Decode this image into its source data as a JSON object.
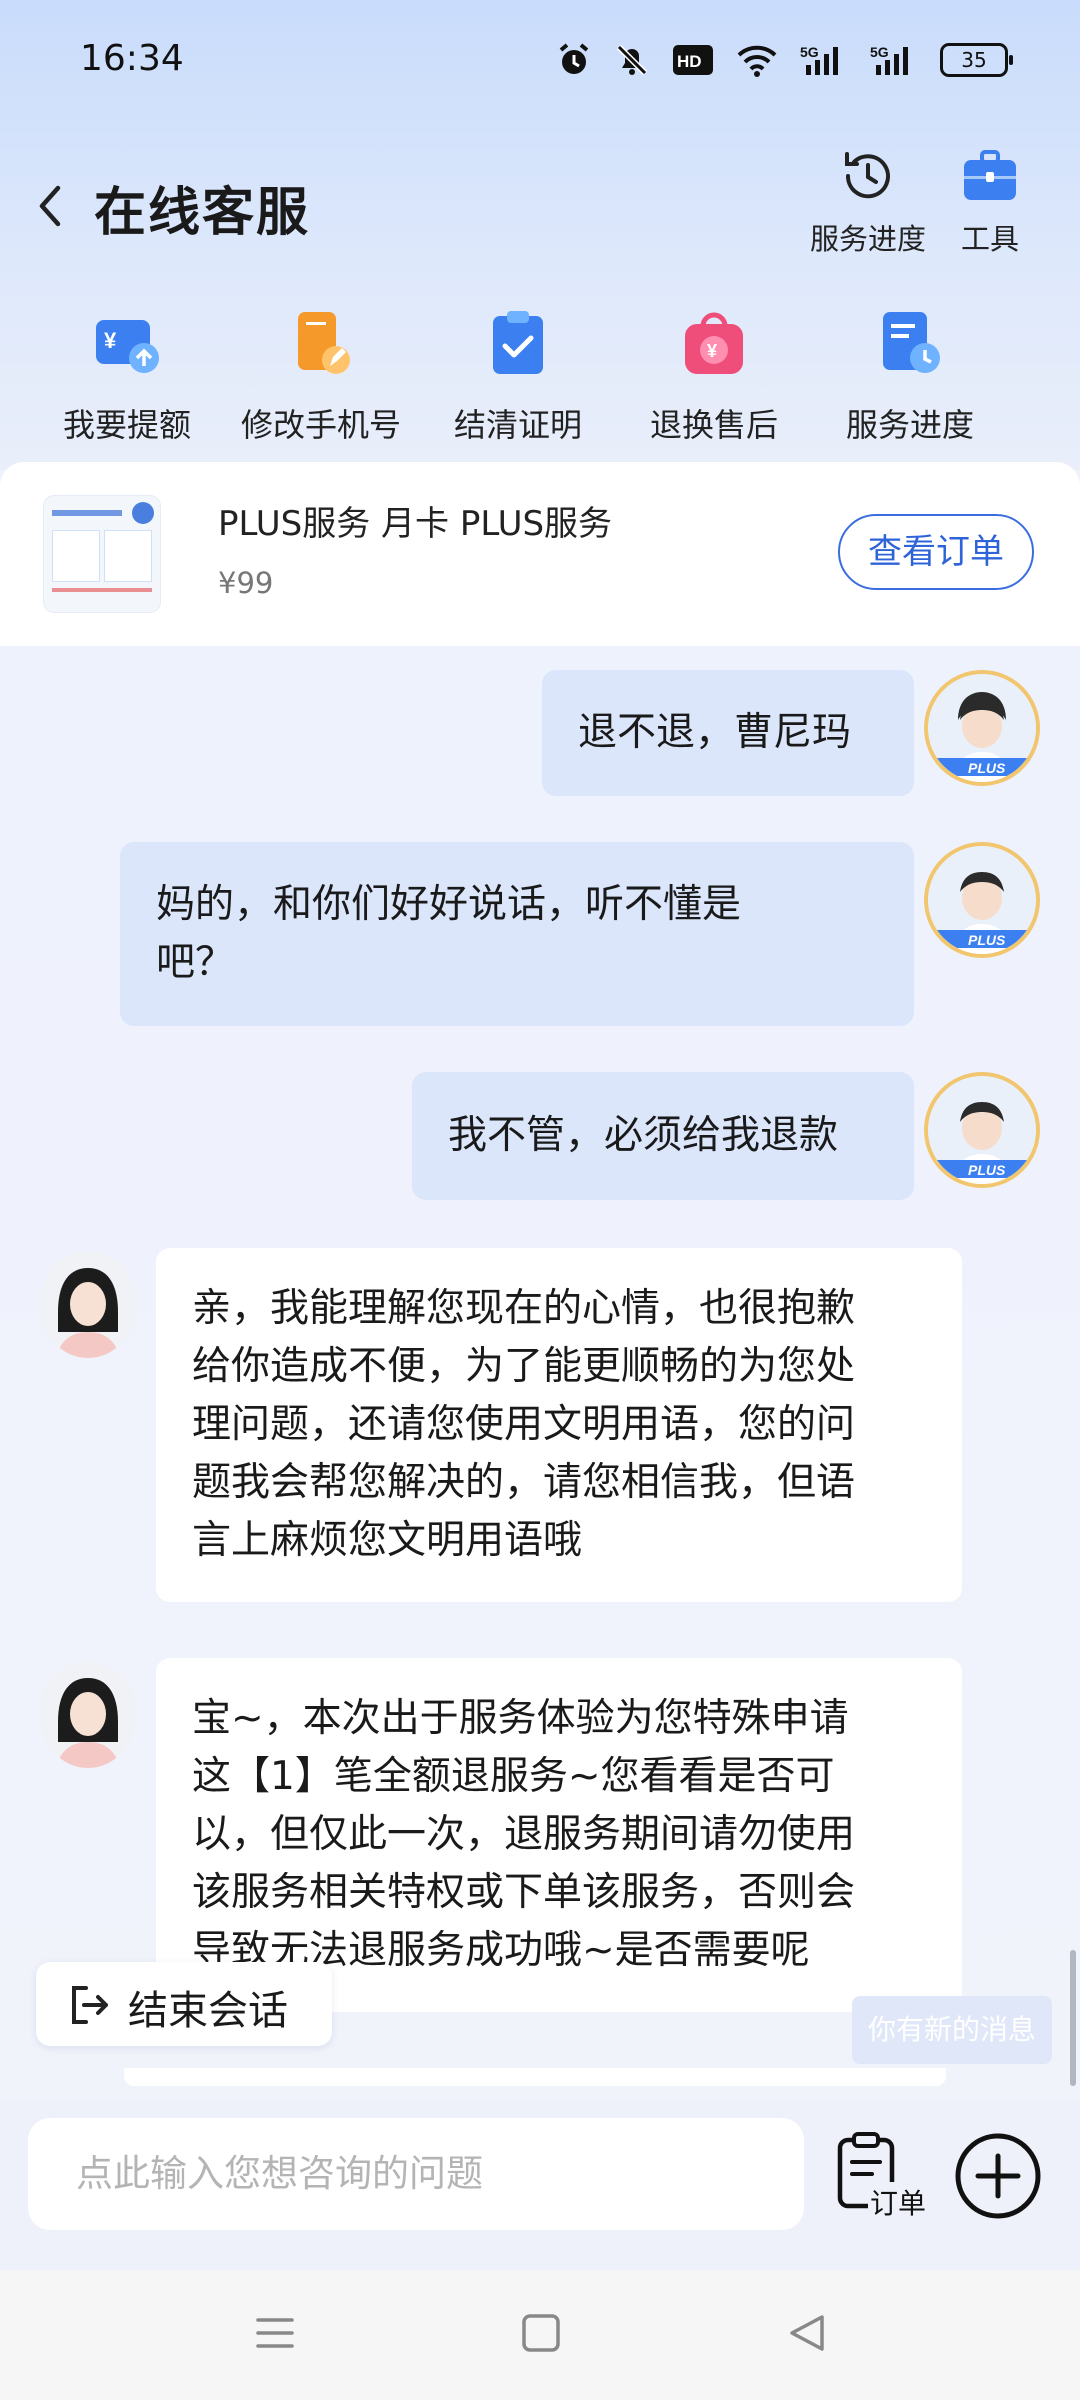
{
  "status_bar": {
    "time": "16:34",
    "icons": [
      "alarm-icon",
      "mute-icon",
      "hd-icon",
      "wifi-icon",
      "5g-signal-icon",
      "5g-signal-icon"
    ],
    "hd_label": "HD",
    "net_label": "5G",
    "battery": "35"
  },
  "header": {
    "title": "在线客服",
    "service_progress": "服务进度",
    "tools": "工具"
  },
  "quick_actions": [
    {
      "label": "我要提额",
      "icon": "wallet-raise-icon",
      "color": "#3b7ff0"
    },
    {
      "label": "修改手机号",
      "icon": "phone-edit-icon",
      "color": "#f59a2a"
    },
    {
      "label": "结清证明",
      "icon": "clipboard-check-icon",
      "color": "#3b7ff0"
    },
    {
      "label": "退换售后",
      "icon": "refund-bag-icon",
      "color": "#ef4d7a"
    },
    {
      "label": "服务进度",
      "icon": "doc-clock-icon",
      "color": "#3b7ff0"
    }
  ],
  "order": {
    "product_name": "PLUS服务 月卡 PLUS服务",
    "price": "¥99",
    "view_button": "查看订单"
  },
  "messages": [
    {
      "from": "user",
      "text": "退不退，曹尼玛"
    },
    {
      "from": "user",
      "lines": [
        "妈的，和你们好好说话，听不懂是",
        "吧？"
      ]
    },
    {
      "from": "user",
      "text": "我不管，必须给我退款"
    },
    {
      "from": "agent",
      "lines": [
        "亲，我能理解您现在的心情，也很抱歉",
        "给你造成不便，为了能更顺畅的为您处",
        "理问题，还请您使用文明用语，您的问",
        "题我会帮您解决的，请您相信我，但语",
        "言上麻烦您文明用语哦"
      ]
    },
    {
      "from": "agent",
      "lines": [
        "宝~，本次出于服务体验为您特殊申请",
        "这【1】笔全额退服务~您看看是否可",
        "以，但仅此一次，退服务期间请勿使用",
        "该服务相关特权或下单该服务，否则会",
        "导致无法退服务成功哦~是否需要呢"
      ]
    }
  ],
  "user_badge": "PLUS",
  "end_session": "结束会话",
  "new_message_hint": "你有新的消息",
  "input": {
    "placeholder": "点此输入您想咨询的问题",
    "order_label": "订单"
  },
  "colors": {
    "accent": "#3a6ee0",
    "bubble_user": "#dbe6fb",
    "bubble_agent": "#ffffff"
  }
}
